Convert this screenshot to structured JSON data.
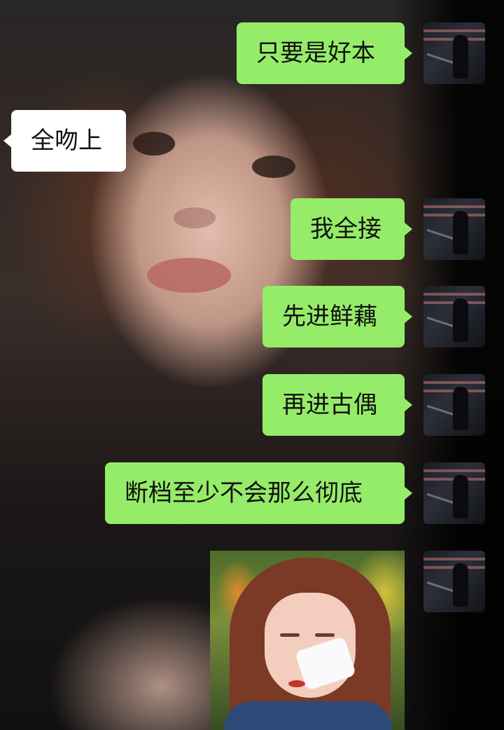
{
  "messages": [
    {
      "id": 1,
      "side": "right",
      "type": "text",
      "text": "只要是好本"
    },
    {
      "id": 2,
      "side": "left",
      "type": "text",
      "text": "全吻上"
    },
    {
      "id": 3,
      "side": "right",
      "type": "text",
      "text": "我全接"
    },
    {
      "id": 4,
      "side": "right",
      "type": "text",
      "text": "先进鲜藕"
    },
    {
      "id": 5,
      "side": "right",
      "type": "text",
      "text": "再进古偶"
    },
    {
      "id": 6,
      "side": "right",
      "type": "text",
      "text": "断档至少不会那么彻底"
    },
    {
      "id": 7,
      "side": "right",
      "type": "image",
      "image": "crying-girl-with-tissue-photo"
    }
  ],
  "colors": {
    "my_bubble": "#95ec69",
    "their_bubble": "#ffffff"
  }
}
